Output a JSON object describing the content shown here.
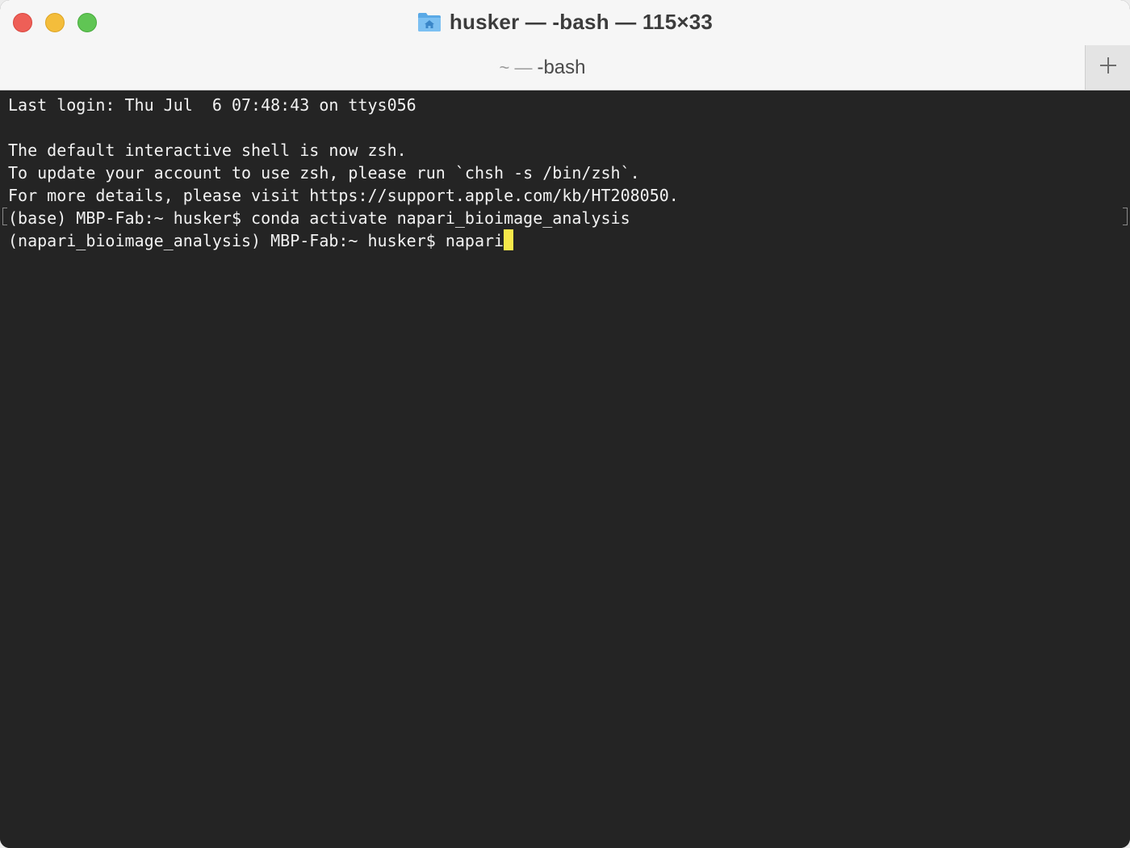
{
  "window": {
    "title": "husker — -bash — 115×33",
    "colors": {
      "close": "#ee5f57",
      "minimize": "#f4bd3b",
      "maximize": "#60c554",
      "terminal_bg": "#242424",
      "terminal_fg": "#f2f2f2",
      "cursor": "#f7e84a"
    }
  },
  "icons": {
    "title_icon": "home-folder-icon",
    "new_tab": "plus-icon"
  },
  "tab": {
    "prefix": "~ —",
    "label": "-bash"
  },
  "terminal": {
    "lines": [
      "Last login: Thu Jul  6 07:48:43 on ttys056",
      "",
      "The default interactive shell is now zsh.",
      "To update your account to use zsh, please run `chsh -s /bin/zsh`.",
      "For more details, please visit https://support.apple.com/kb/HT208050.",
      "(base) MBP-Fab:~ husker$ conda activate napari_bioimage_analysis",
      "(napari_bioimage_analysis) MBP-Fab:~ husker$ napari"
    ]
  }
}
